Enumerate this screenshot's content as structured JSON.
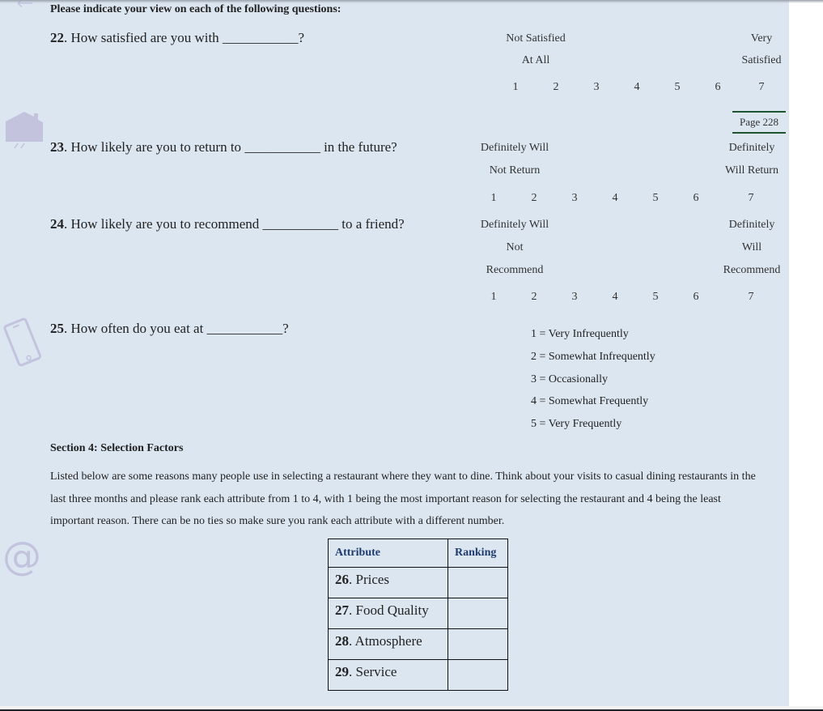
{
  "header": {
    "instruction": "Please indicate your view on each of the following questions:"
  },
  "questions": [
    {
      "number": "22",
      "text_before": ". How satisfied are you with ",
      "blank": "___________",
      "text_after": "?",
      "low_anchor": [
        "Not Satisfied",
        "At All"
      ],
      "high_anchor": [
        "Very",
        "Satisfied"
      ],
      "scale": [
        "1",
        "2",
        "3",
        "4",
        "5",
        "6",
        "7"
      ]
    },
    {
      "number": "23",
      "text_before": ". How likely are you to return to ",
      "blank": "___________",
      "text_after": " in the future?",
      "low_anchor": [
        "Definitely Will",
        "Not Return"
      ],
      "high_anchor": [
        "Definitely",
        "Will Return"
      ],
      "scale": [
        "1",
        "2",
        "3",
        "4",
        "5",
        "6",
        "7"
      ]
    },
    {
      "number": "24",
      "text_before": ". How likely are you to recommend ",
      "blank": "___________",
      "text_after": " to a friend?",
      "low_anchor": [
        "Definitely Will",
        "Not",
        "Recommend"
      ],
      "high_anchor": [
        "Definitely",
        "Will",
        "Recommend"
      ],
      "scale": [
        "1",
        "2",
        "3",
        "4",
        "5",
        "6",
        "7"
      ]
    },
    {
      "number": "25",
      "text_before": ". How often do you eat at ",
      "blank": "___________",
      "text_after": "?",
      "options": [
        "1 = Very Infrequently",
        "2 = Somewhat Infrequently",
        "3 = Occasionally",
        "4 = Somewhat Frequently",
        "5 = Very Frequently"
      ]
    }
  ],
  "page_label": "Page 228",
  "section4": {
    "title": "Section 4: Selection Factors",
    "paragraph": "Listed below are some reasons many people use in selecting a restaurant where they want to dine. Think about your visits to casual dining restaurants in the last three months and please rank each attribute from 1 to 4, with 1 being the most important reason for selecting the restaurant and 4 being the least important reason. There can be no ties so make sure you rank each attribute with a different number.",
    "table": {
      "headers": [
        "Attribute",
        "Ranking"
      ],
      "rows": [
        {
          "number": "26",
          "label": ". Prices",
          "ranking": ""
        },
        {
          "number": "27",
          "label": ". Food Quality",
          "ranking": ""
        },
        {
          "number": "28",
          "label": ". Atmosphere",
          "ranking": ""
        },
        {
          "number": "29",
          "label": ". Service",
          "ranking": ""
        }
      ]
    }
  },
  "decor_icons": [
    "back-arrow-icon",
    "house-icon",
    "smartphone-icon",
    "at-sign-icon"
  ],
  "colors": {
    "page_bg": "#dce6f1",
    "page_tag_rule": "#1e5631",
    "table_header_text": "#1d3b6e",
    "decor_icon": "#c3c3de"
  }
}
